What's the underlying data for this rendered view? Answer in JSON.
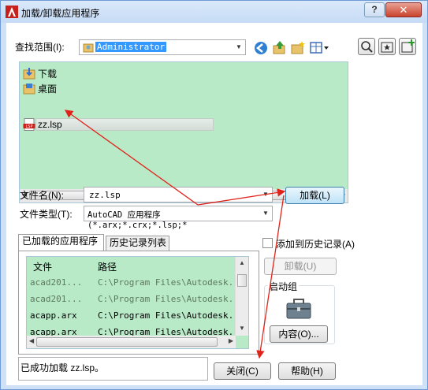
{
  "window": {
    "title": "加载/卸载应用程序",
    "help_button": "?",
    "close_button": "✕"
  },
  "lookin": {
    "label": "查找范围(I):",
    "value": "Administrator"
  },
  "files": [
    {
      "name": "下载",
      "type": "folder"
    },
    {
      "name": "桌面",
      "type": "folder"
    },
    {
      "name": "zz.lsp",
      "type": "lsp"
    }
  ],
  "lsp_badge": "LSP",
  "filename": {
    "label": "文件名(N):",
    "value": "zz.lsp"
  },
  "filetype": {
    "label": "文件类型(T):",
    "value": "AutoCAD 应用程序(*.arx;*.crx;*.lsp;*"
  },
  "load_button": "加载(L)",
  "tabs": {
    "loaded": "已加载的应用程序",
    "history": "历史记录列表"
  },
  "table": {
    "col_file": "文件",
    "col_path": "路径",
    "rows": [
      {
        "file": "acad201...",
        "path": "C:\\Program Files\\Autodesk..."
      },
      {
        "file": "acad201...",
        "path": "C:\\Program Files\\Autodesk..."
      },
      {
        "file": "acapp.arx",
        "path": "C:\\Program Files\\Autodesk..."
      },
      {
        "file": "acapp.arx",
        "path": "C:\\Program Files\\Autodesk..."
      }
    ]
  },
  "add_history": "添加到历史记录(A)",
  "unload_button": "卸载(U)",
  "startup_group": {
    "label": "启动组",
    "contents_button": "内容(O)..."
  },
  "status_text": "已成功加载 zz.lsp。",
  "close_label": "关闭(C)",
  "help_label": "帮助(H)",
  "colors": {
    "list_background": "#b9eac8",
    "annotation_arrow": "#e0231a",
    "title_bar": "#cfe1f7"
  }
}
